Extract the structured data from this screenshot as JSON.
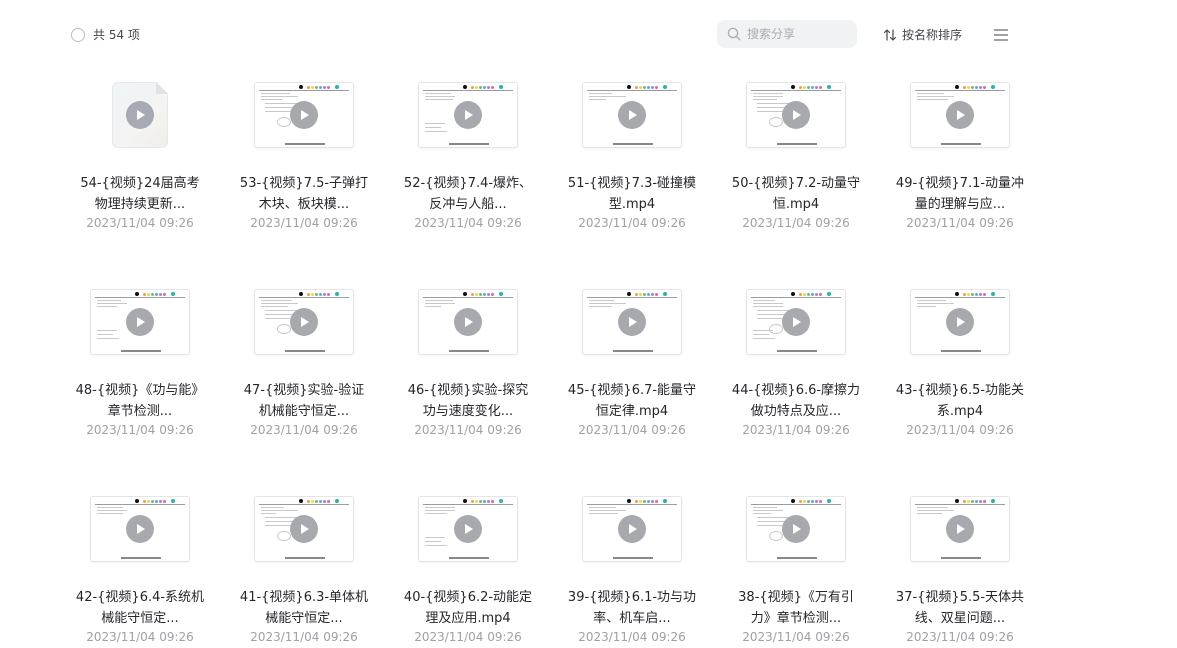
{
  "header": {
    "count_label": "共 54 项",
    "search_placeholder": "搜索分享",
    "sort_label": "按名称排序"
  },
  "colors": {
    "accent_check": "#b8bcc4",
    "play_button": "#a8a9ae",
    "name_text": "#25262b",
    "date_text": "#9fa1a7"
  },
  "icons": {
    "checkbox": "circle-checkbox-icon",
    "search": "search-icon",
    "sort": "sort-arrows-icon",
    "menu": "list-menu-icon",
    "play": "play-icon"
  },
  "files": [
    {
      "name": "54-{视频}24届高考物理持续更新...",
      "date": "2023/11/04 09:26",
      "thumb": "file"
    },
    {
      "name": "53-{视频}7.5-子弹打木块、板块模...",
      "date": "2023/11/04 09:26",
      "thumb": "doc"
    },
    {
      "name": "52-{视频}7.4-爆炸、反冲与人船...",
      "date": "2023/11/04 09:26",
      "thumb": "doc"
    },
    {
      "name": "51-{视频}7.3-碰撞模型.mp4",
      "date": "2023/11/04 09:26",
      "thumb": "doc"
    },
    {
      "name": "50-{视频}7.2-动量守恒.mp4",
      "date": "2023/11/04 09:26",
      "thumb": "doc"
    },
    {
      "name": "49-{视频}7.1-动量冲量的理解与应...",
      "date": "2023/11/04 09:26",
      "thumb": "doc"
    },
    {
      "name": "48-{视频}《功与能》章节检测...",
      "date": "2023/11/04 09:26",
      "thumb": "doc"
    },
    {
      "name": "47-{视频}实验-验证机械能守恒定...",
      "date": "2023/11/04 09:26",
      "thumb": "doc"
    },
    {
      "name": "46-{视频}实验-探究功与速度变化...",
      "date": "2023/11/04 09:26",
      "thumb": "doc"
    },
    {
      "name": "45-{视频}6.7-能量守恒定律.mp4",
      "date": "2023/11/04 09:26",
      "thumb": "doc"
    },
    {
      "name": "44-{视频}6.6-摩擦力做功特点及应...",
      "date": "2023/11/04 09:26",
      "thumb": "doc"
    },
    {
      "name": "43-{视频}6.5-功能关系.mp4",
      "date": "2023/11/04 09:26",
      "thumb": "doc"
    },
    {
      "name": "42-{视频}6.4-系统机械能守恒定...",
      "date": "2023/11/04 09:26",
      "thumb": "doc"
    },
    {
      "name": "41-{视频}6.3-单体机械能守恒定...",
      "date": "2023/11/04 09:26",
      "thumb": "doc"
    },
    {
      "name": "40-{视频}6.2-动能定理及应用.mp4",
      "date": "2023/11/04 09:26",
      "thumb": "doc"
    },
    {
      "name": "39-{视频}6.1-功与功率、机车启...",
      "date": "2023/11/04 09:26",
      "thumb": "doc"
    },
    {
      "name": "38-{视频}《万有引力》章节检测...",
      "date": "2023/11/04 09:26",
      "thumb": "doc"
    },
    {
      "name": "37-{视频}5.5-天体共线、双星问题...",
      "date": "2023/11/04 09:26",
      "thumb": "doc"
    }
  ]
}
